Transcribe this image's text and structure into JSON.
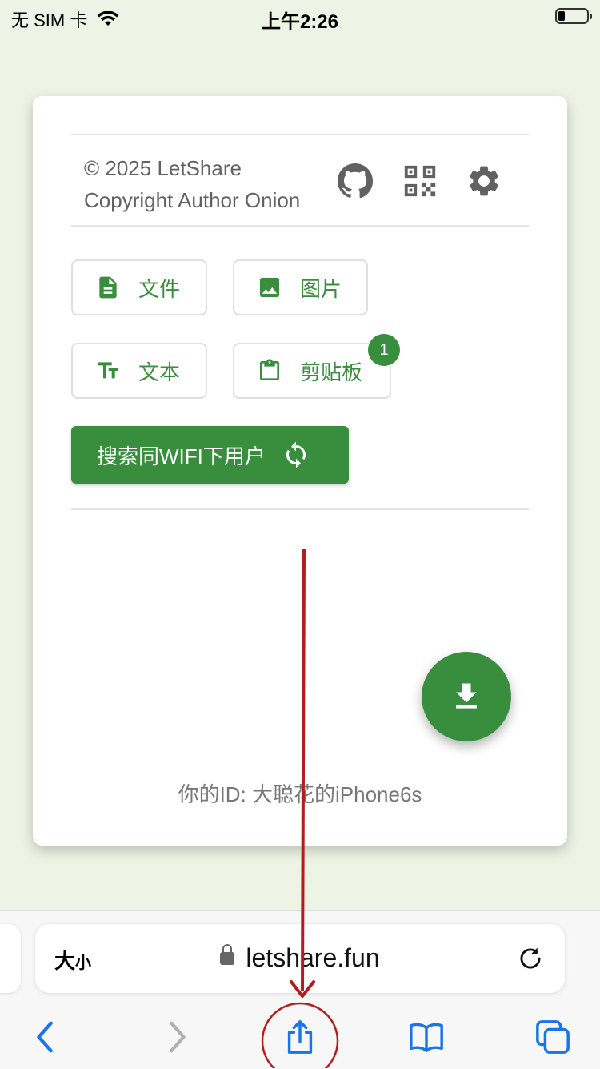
{
  "status_bar": {
    "carrier": "无 SIM 卡",
    "time": "上午2:26"
  },
  "footer": {
    "copyright": "© 2025 LetShare",
    "author": "Copyright Author Onion"
  },
  "buttons": {
    "file": "文件",
    "image": "图片",
    "text": "文本",
    "clipboard": "剪贴板",
    "clipboard_badge": "1",
    "search_wifi": "搜索同WIFI下用户"
  },
  "my_id": "你的ID: 大聪花的iPhone6s",
  "safari": {
    "text_size_big": "大",
    "text_size_small": "小",
    "url": "letshare.fun"
  },
  "colors": {
    "accent": "#388e3c",
    "annotation": "#b71c1c"
  },
  "icons": [
    "github-icon",
    "qrcode-icon",
    "settings-gear-icon",
    "file-icon",
    "image-icon",
    "text-icon",
    "clipboard-icon",
    "sync-icon",
    "download-icon",
    "lock-icon",
    "reload-icon",
    "back-icon",
    "forward-icon",
    "share-icon",
    "bookmarks-icon",
    "tabs-icon"
  ]
}
